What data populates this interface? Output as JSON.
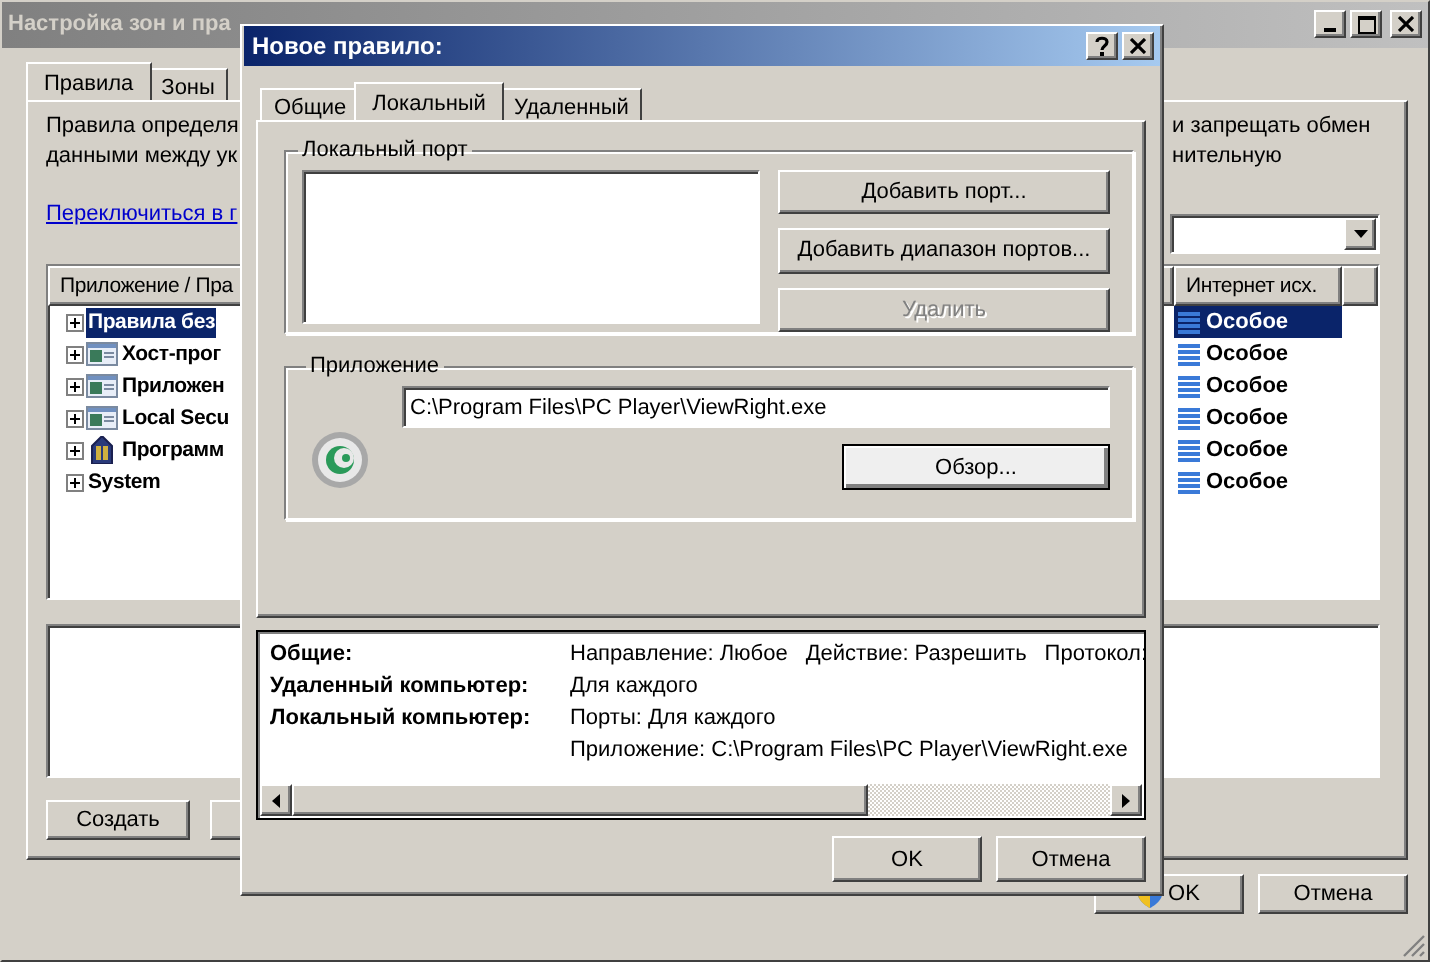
{
  "main_window": {
    "title": "Настройка зон и пра",
    "tabs": [
      {
        "label": "Правила",
        "selected": true
      },
      {
        "label": "Зоны",
        "selected": false
      }
    ],
    "description_left": [
      "Правила определя",
      "данными между ук"
    ],
    "description_right": [
      "и запрещать обмен",
      "нительную"
    ],
    "link": "Переключиться в г",
    "tree": {
      "columns": [
        "Приложение / Пра",
        "Интернет исх."
      ],
      "rows": [
        {
          "label": "Правила без",
          "kind": "group",
          "selected": true,
          "outbound": "Особое"
        },
        {
          "label": "Хост-прог",
          "kind": "app",
          "selected": false,
          "outbound": "Особое"
        },
        {
          "label": "Приложен",
          "kind": "app",
          "selected": false,
          "outbound": "Особое"
        },
        {
          "label": "Local Secu",
          "kind": "app",
          "selected": false,
          "outbound": "Особое"
        },
        {
          "label": "Программ",
          "kind": "program",
          "selected": false,
          "outbound": "Особое"
        },
        {
          "label": "System",
          "kind": "group",
          "selected": false,
          "outbound": "Особое"
        }
      ]
    },
    "left_buttons": [
      "Создать"
    ],
    "buttons": [
      "OK",
      "Отмена"
    ]
  },
  "dialog": {
    "title": "Новое правило:",
    "tabs": [
      {
        "label": "Общие",
        "selected": false
      },
      {
        "label": "Локальный",
        "selected": true
      },
      {
        "label": "Удаленный",
        "selected": false
      }
    ],
    "local_port": {
      "title": "Локальный порт",
      "buttons": [
        {
          "label": "Добавить порт...",
          "disabled": false
        },
        {
          "label": "Добавить диапазон портов...",
          "disabled": false
        },
        {
          "label": "Удалить",
          "disabled": true
        }
      ]
    },
    "application": {
      "title": "Приложение",
      "path": "C:\\Program Files\\PC Player\\ViewRight.exe",
      "browse": "Обзор..."
    },
    "summary": [
      {
        "label": "Общие:",
        "values": [
          "Направление: Любое",
          "Действие: Разрешить",
          "Протокол:"
        ]
      },
      {
        "label": "Удаленный компьютер:",
        "values": [
          "Для каждого"
        ]
      },
      {
        "label": "Локальный компьютер:",
        "values": [
          "Порты: Для каждого"
        ]
      },
      {
        "values": [
          "Приложение: C:\\Program Files\\PC Player\\ViewRight.exe"
        ]
      }
    ],
    "buttons": [
      "OK",
      "Отмена"
    ]
  }
}
